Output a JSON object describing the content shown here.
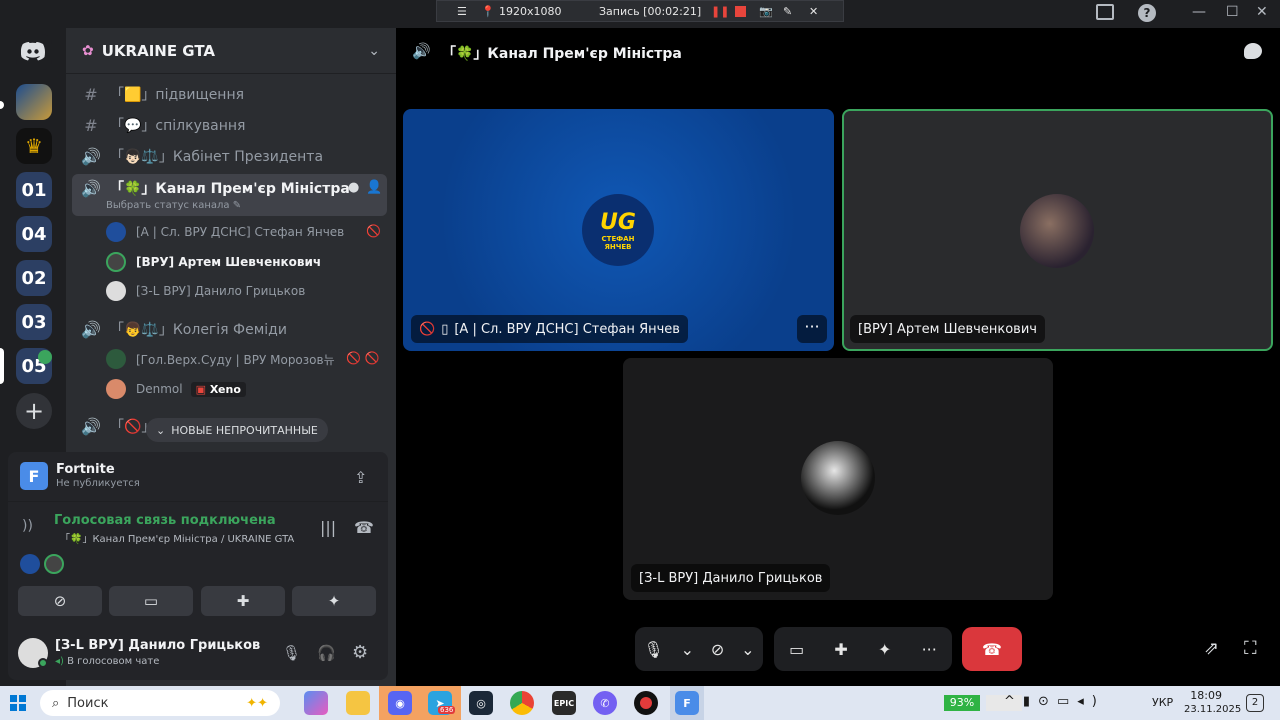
{
  "recorder": {
    "resolution": "1920x1080",
    "record_label": "Запись [00:02:21]"
  },
  "server": {
    "name": "UKRAINE GTA"
  },
  "channels": [
    {
      "name": "「🟨」підвищення",
      "type": "text"
    },
    {
      "name": "「💬」спілкування",
      "type": "text"
    },
    {
      "name": "「👦🏻⚖️」Кабінет Президента",
      "type": "voice"
    },
    {
      "name": "「🍀」Канал Прем'єр Міністра",
      "type": "voice",
      "active": true
    },
    {
      "name": "「👦⚖️」Колегія Феміди",
      "type": "voice"
    },
    {
      "name": "「🚫」",
      "type": "voice"
    }
  ],
  "active_channel": {
    "status_hint": "Выбрать статус канала",
    "members": [
      {
        "name": "[А | Сл. ВРУ ДСНС] Стефан Янчев"
      },
      {
        "name": "[ВРУ] Артем Шевченкович"
      },
      {
        "name": "[З-L ВРУ] Данило Грицьков"
      }
    ]
  },
  "femida_members": [
    {
      "name": "[Гол.Верх.Суду | ВРУ Морозов뉴"
    },
    {
      "name": "Denmol",
      "tag": "Xeno"
    }
  ],
  "unread_pill": "НОВЫЕ НЕПРОЧИТАННЫЕ",
  "activity": {
    "game": "Fortnite",
    "status": "Не публикуется"
  },
  "voice": {
    "connected": "Голосовая связь подключена",
    "channel_path": "「🍀」Канал Прем'єр Міністра / UKRAINE GTA"
  },
  "user": {
    "name": "[З-L ВРУ] Данило Грицьков",
    "status": "В голосовом чате"
  },
  "main": {
    "header_title": "「🍀」Канал Прем'єр Міністра",
    "tiles": [
      {
        "name": "[А | Сл. ВРУ ДСНС] Стефан Янчев",
        "logo_top": "UG",
        "logo_bottom": "СТЕФАН ЯНЧЕВ"
      },
      {
        "name": "[ВРУ] Артем Шевченкович"
      },
      {
        "name": "[З-L ВРУ] Данило Грицьков"
      }
    ]
  },
  "taskbar": {
    "search_placeholder": "Поиск",
    "battery": "93%",
    "lang": "УКР",
    "time": "18:09",
    "date": "23.11.2025",
    "telegram_badge": "636",
    "notif_count": "2"
  },
  "colors": {
    "accent_green": "#3ba55d",
    "end_call_red": "#da373c",
    "tile_blue": "#0a3f8c"
  }
}
